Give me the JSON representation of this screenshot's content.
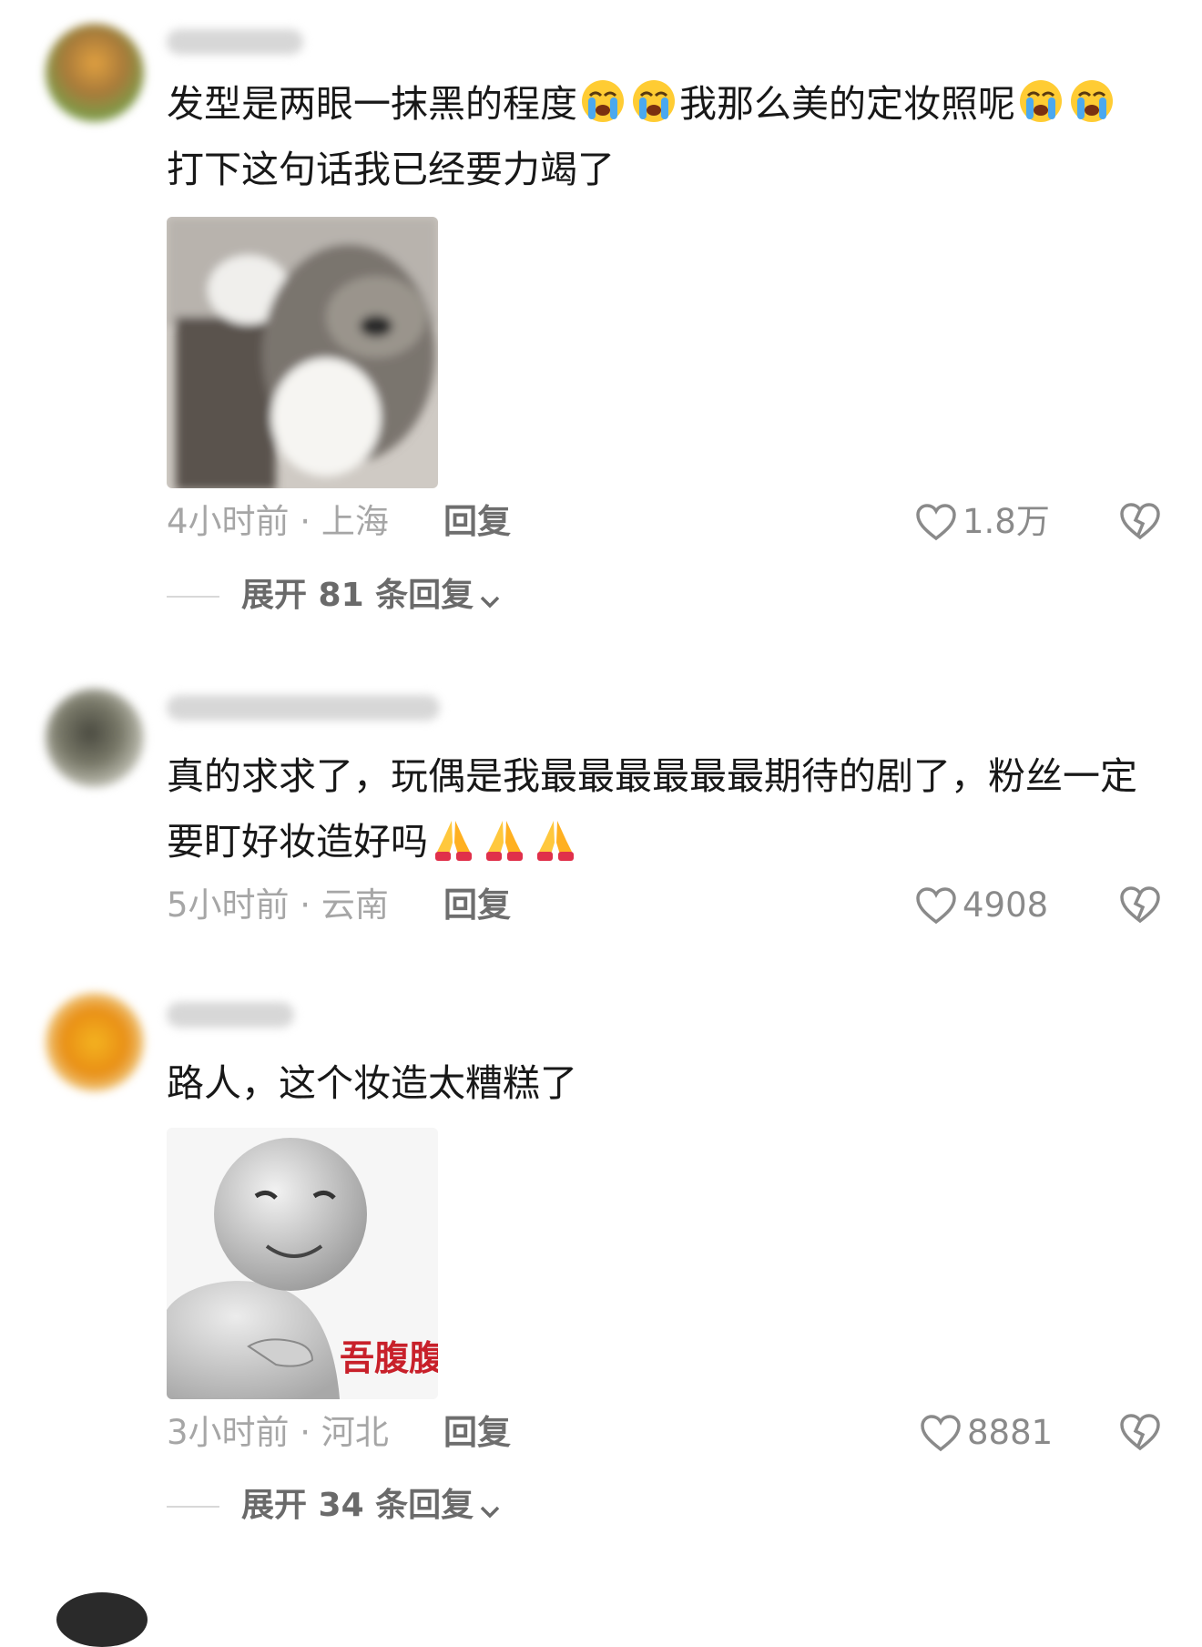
{
  "comments": [
    {
      "text_prefix": "发型是两眼一抹黑的程度",
      "text_middle": "我那么美的定妆照呢",
      "text_suffix": "打下这句话我已经要力竭了",
      "emoji": "loudly-crying-face",
      "time": "4小时前 · 上海",
      "reply_label": "回复",
      "likes": "1.8万",
      "expand_label": "展开 81 条回复",
      "image": "cat-gif"
    },
    {
      "text": "真的求求了，玩偶是我最最最最最最期待的剧了，粉丝一定要盯好妆造好吗",
      "emoji": "folded-hands",
      "time": "5小时前 · 云南",
      "reply_label": "回复",
      "likes": "4908"
    },
    {
      "text": "路人，这个妆造太糟糕了",
      "time": "3小时前 · 河北",
      "reply_label": "回复",
      "likes": "8881",
      "expand_label": "展开 34 条回复",
      "image": "meme",
      "image_caption": "吾腹腹"
    }
  ],
  "colors": {
    "meta_gray": "#a6a6a6",
    "reply_gray": "#6e6e6e",
    "text": "#181818"
  }
}
